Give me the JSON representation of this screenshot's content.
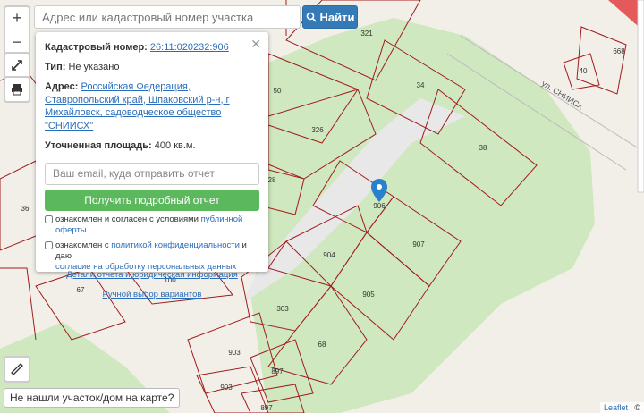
{
  "map": {
    "streets": [
      {
        "name": "ул. СНИИСХ"
      }
    ],
    "parcels": [
      "321",
      "34",
      "38",
      "668",
      "40",
      "50",
      "326",
      "28",
      "36",
      "906",
      "907",
      "904",
      "905",
      "303",
      "68",
      "67",
      "100",
      "903",
      "897",
      "903",
      "897",
      "77"
    ],
    "icons": {
      "marker": "location-pin-icon"
    }
  },
  "controls": {
    "zoom_in": "+",
    "zoom_out": "−"
  },
  "search": {
    "placeholder": "Адрес или кадастровый номер участка",
    "button_label": "Найти"
  },
  "popup": {
    "cadastral_label": "Кадастровый номер:",
    "cadastral_value": "26:11:020232:906",
    "type_label": "Тип:",
    "type_value": "Не указано",
    "address_label": "Адрес:",
    "address_value": "Российская Федерация, Ставропольский край, Шпаковский р-н, г Михайловск, садоводческое общество \"СНИИСХ\"",
    "area_label": "Уточненная площадь:",
    "area_value": "400 кв.м.",
    "email_placeholder": "Ваш email, куда отправить отчет",
    "report_button": "Получить подробный отчет",
    "consent1_prefix": "ознакомлен и согласен с условиями ",
    "consent1_link": "публичной оферты",
    "consent2_prefix": "ознакомлен с ",
    "consent2_link1": "политикой конфиденциальности",
    "consent2_mid": " и даю",
    "consent2_link2": "согласие на обработку персональных данных",
    "report_details_link": "Детали отчета и юридическая информация",
    "manual_variants_link": "Ручной выбор вариантов"
  },
  "footer": {
    "not_found": "Не нашли участок/дом на карте?",
    "attribution_link": "Leaflet",
    "attribution_sep": " | ©"
  },
  "colors": {
    "parcel_border": "#a01c1c",
    "park_green": "#cfe8bf",
    "marker_blue": "#2a81cb",
    "search_button": "#337ab7",
    "report_button": "#5cb85c"
  }
}
